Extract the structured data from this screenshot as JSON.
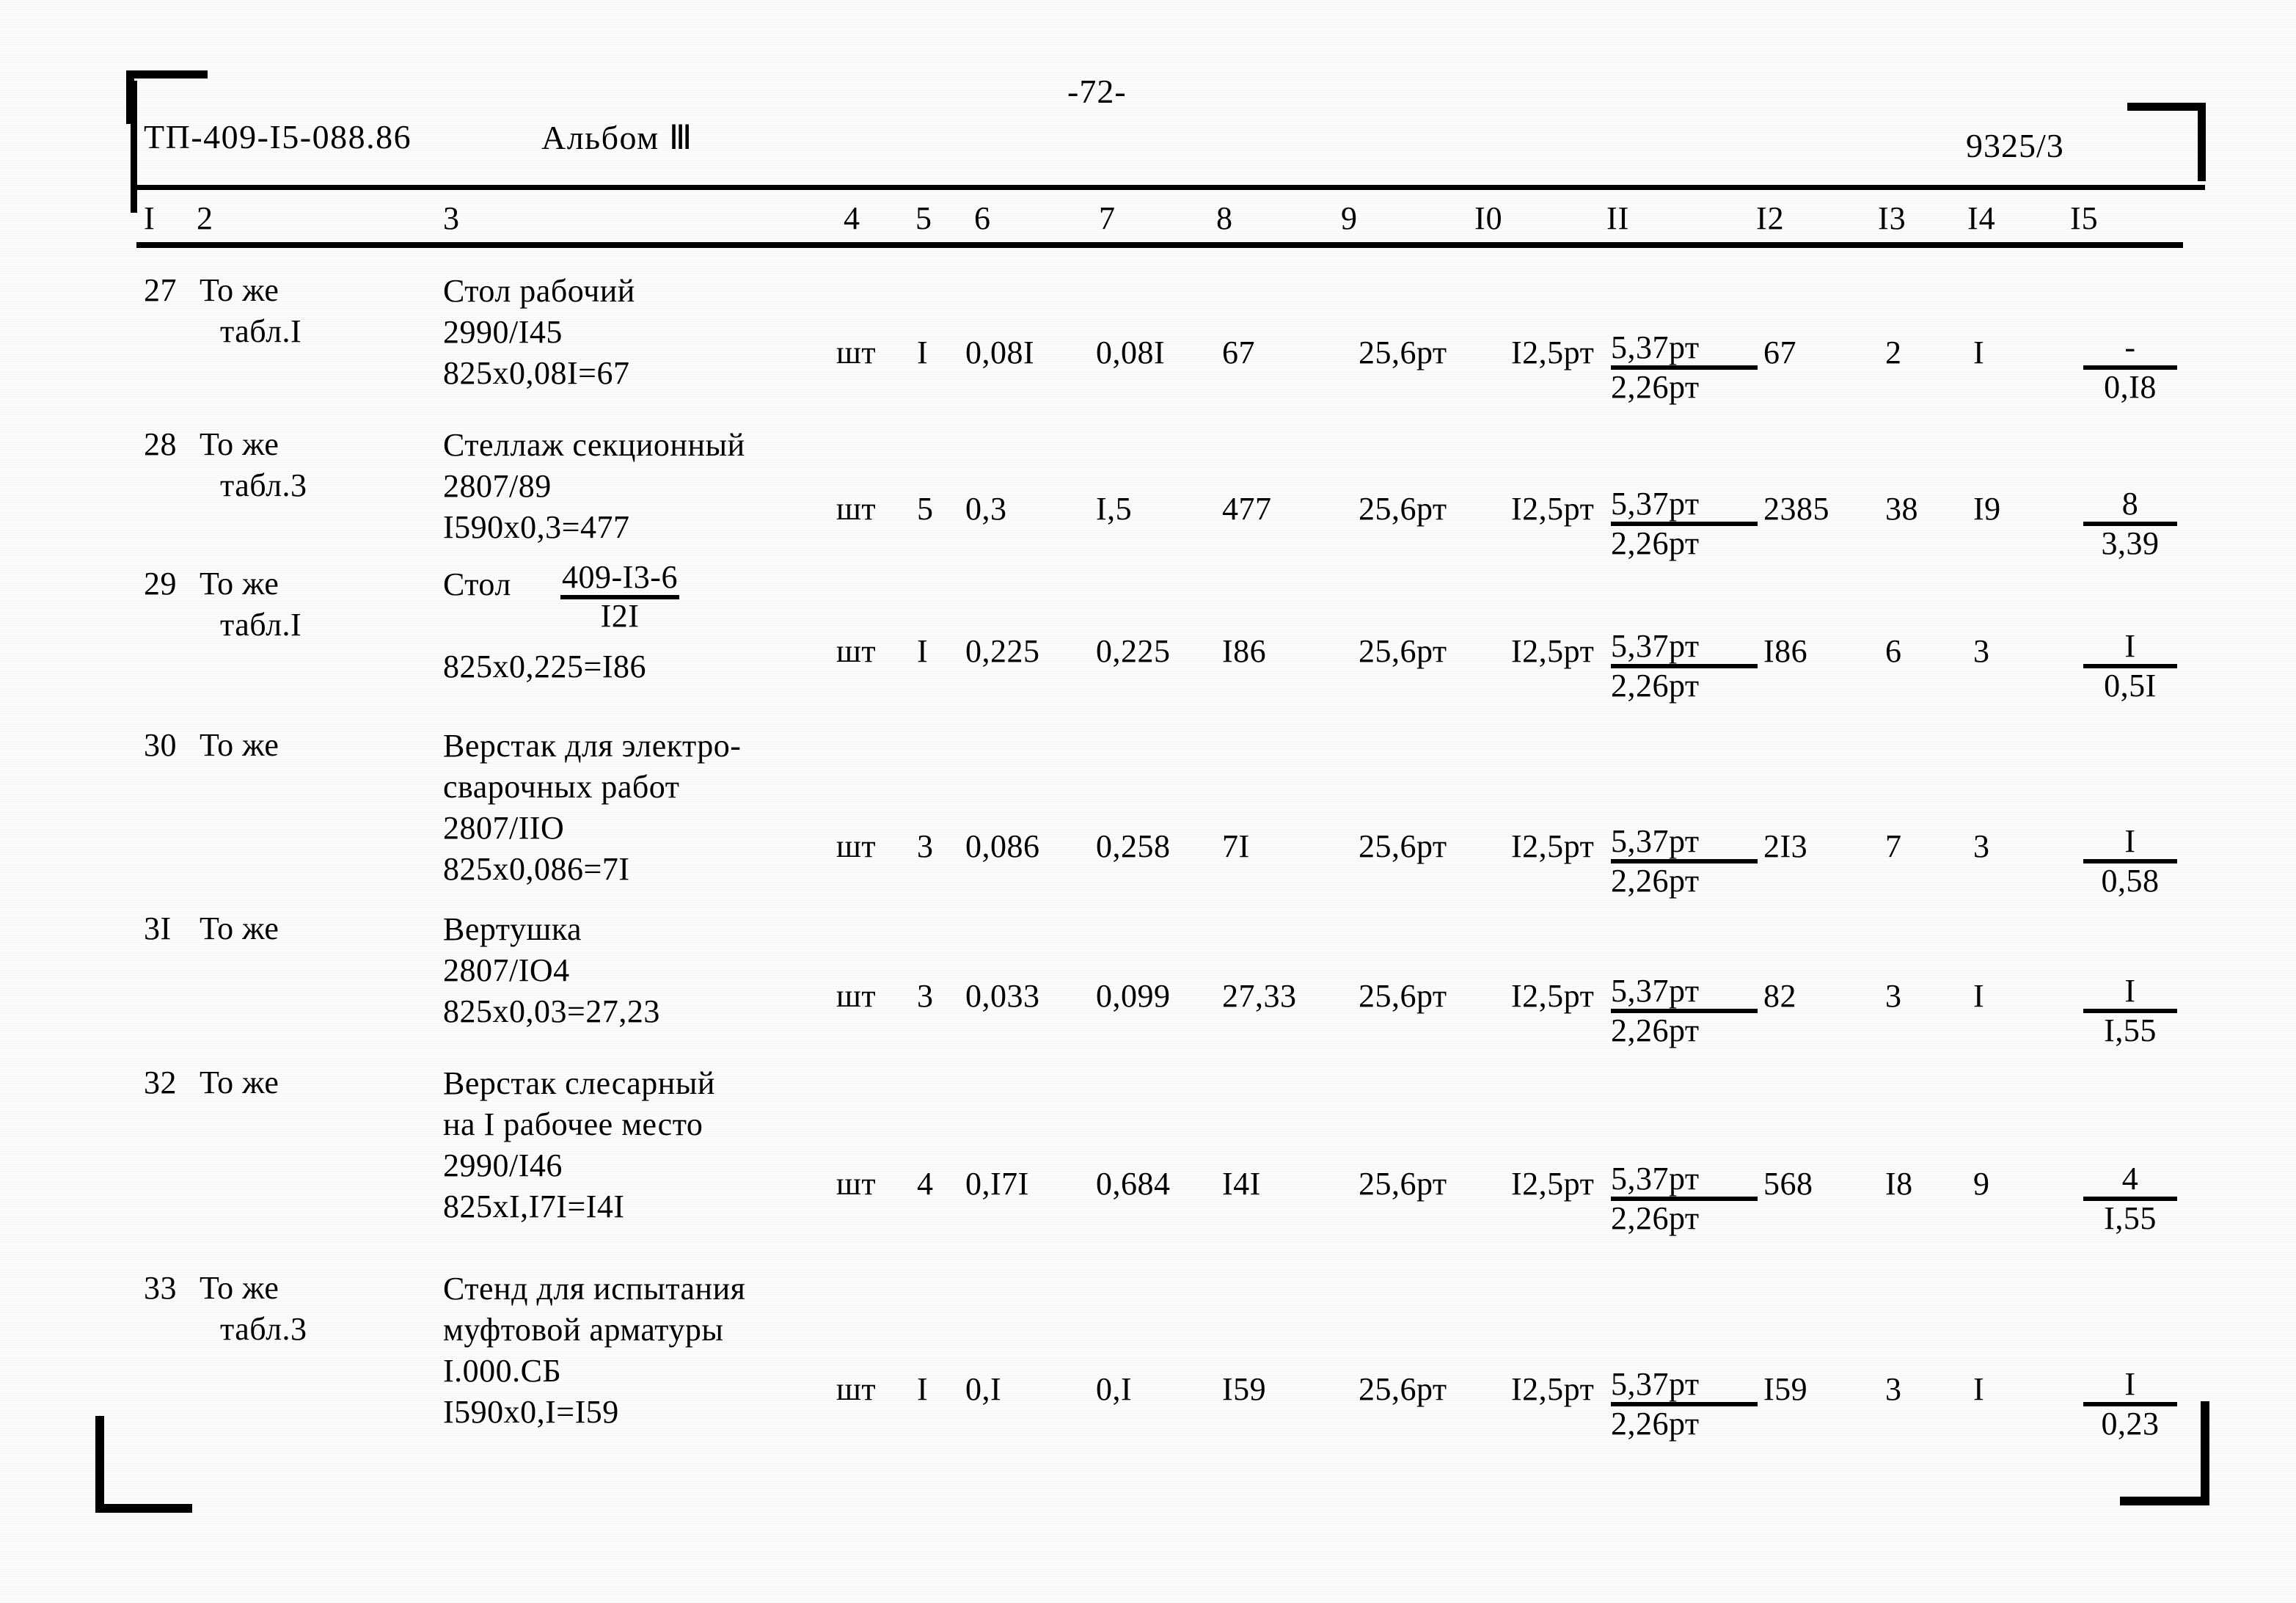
{
  "header": {
    "doc_code": "ТП-409-I5-088.86",
    "album": "Альбом Ⅲ",
    "page_number": "-72-",
    "sheet_code": "9325/3"
  },
  "table": {
    "column_headers": [
      "I",
      "2",
      "3",
      "4",
      "5",
      "6",
      "7",
      "8",
      "9",
      "I0",
      "II",
      "I2",
      "I3",
      "I4",
      "I5"
    ],
    "rows": [
      {
        "num": "27",
        "justification": [
          "То же",
          "табл.I"
        ],
        "description": [
          "Стол рабочий",
          "2990/I45",
          "825х0,08I=67"
        ],
        "unit": "шт",
        "qty": "I",
        "c6": "0,08I",
        "c7": "0,08I",
        "c8": "67",
        "c9": "",
        "c10": "25,6рт",
        "c11": "I2,5рт",
        "c12_top": "5,37рт",
        "c12_bot": "2,26рт",
        "c13": "67",
        "c14": "2",
        "c15": "I",
        "c16_top": "-",
        "c16_bot": "0,I8"
      },
      {
        "num": "28",
        "justification": [
          "То же",
          "табл.3"
        ],
        "description": [
          "Стеллаж секционный",
          "2807/89",
          "I590х0,3=477"
        ],
        "unit": "шт",
        "qty": "5",
        "c6": "0,3",
        "c7": "I,5",
        "c8": "477",
        "c9": "",
        "c10": "25,6рт",
        "c11": "I2,5рт",
        "c12_top": "5,37рт",
        "c12_bot": "2,26рт",
        "c13": "2385",
        "c14": "38",
        "c15": "I9",
        "c16_top": "8",
        "c16_bot": "3,39"
      },
      {
        "num": "29",
        "justification": [
          "То же",
          "табл.I"
        ],
        "description": [
          "Стол",
          "825х0,225=I86"
        ],
        "desc_fraction": {
          "num": "409-I3-6",
          "den": "I2I"
        },
        "unit": "шт",
        "qty": "I",
        "c6": "0,225",
        "c7": "0,225",
        "c8": "I86",
        "c9": "",
        "c10": "25,6рт",
        "c11": "I2,5рт",
        "c12_top": "5,37рт",
        "c12_bot": "2,26рт",
        "c13": "I86",
        "c14": "6",
        "c15": "3",
        "c16_top": "I",
        "c16_bot": "0,5I"
      },
      {
        "num": "30",
        "justification": [
          "То же"
        ],
        "description": [
          "Верстак для электро-",
          "сварочных работ",
          "2807/IIO",
          "825х0,086=7I"
        ],
        "unit": "шт",
        "qty": "3",
        "c6": "0,086",
        "c7": "0,258",
        "c8": "7I",
        "c9": "",
        "c10": "25,6рт",
        "c11": "I2,5рт",
        "c12_top": "5,37рт",
        "c12_bot": "2,26рт",
        "c13": "2I3",
        "c14": "7",
        "c15": "3",
        "c16_top": "I",
        "c16_bot": "0,58"
      },
      {
        "num": "3I",
        "justification": [
          "То же"
        ],
        "description": [
          "Вертушка",
          "2807/IO4",
          "825х0,03=27,23"
        ],
        "unit": "шт",
        "qty": "3",
        "c6": "0,033",
        "c7": "0,099",
        "c8": "27,33",
        "c9": "",
        "c10": "25,6рт",
        "c11": "I2,5рт",
        "c12_top": "5,37рт",
        "c12_bot": "2,26рт",
        "c13": "82",
        "c14": "3",
        "c15": "I",
        "c16_top": "I",
        "c16_bot": "I,55"
      },
      {
        "num": "32",
        "justification": [
          "То же"
        ],
        "description": [
          "Верстак слесарный",
          "на I рабочее место",
          "2990/I46",
          "825хI,I7I=I4I"
        ],
        "unit": "шт",
        "qty": "4",
        "c6": "0,I7I",
        "c7": "0,684",
        "c8": "I4I",
        "c9": "",
        "c10": "25,6рт",
        "c11": "I2,5рт",
        "c12_top": "5,37рт",
        "c12_bot": "2,26рт",
        "c13": "568",
        "c14": "I8",
        "c15": "9",
        "c16_top": "4",
        "c16_bot": "I,55"
      },
      {
        "num": "33",
        "justification": [
          "То же",
          "табл.3"
        ],
        "description": [
          "Стенд для испытания",
          "муфтовой арматуры",
          "I.000.СБ",
          "I590х0,I=I59"
        ],
        "unit": "шт",
        "qty": "I",
        "c6": "0,I",
        "c7": "0,I",
        "c8": "I59",
        "c9": "",
        "c10": "25,6рт",
        "c11": "I2,5рт",
        "c12_top": "5,37рт",
        "c12_bot": "2,26рт",
        "c13": "I59",
        "c14": "3",
        "c15": "I",
        "c16_top": "I",
        "c16_bot": "0,23"
      }
    ]
  }
}
